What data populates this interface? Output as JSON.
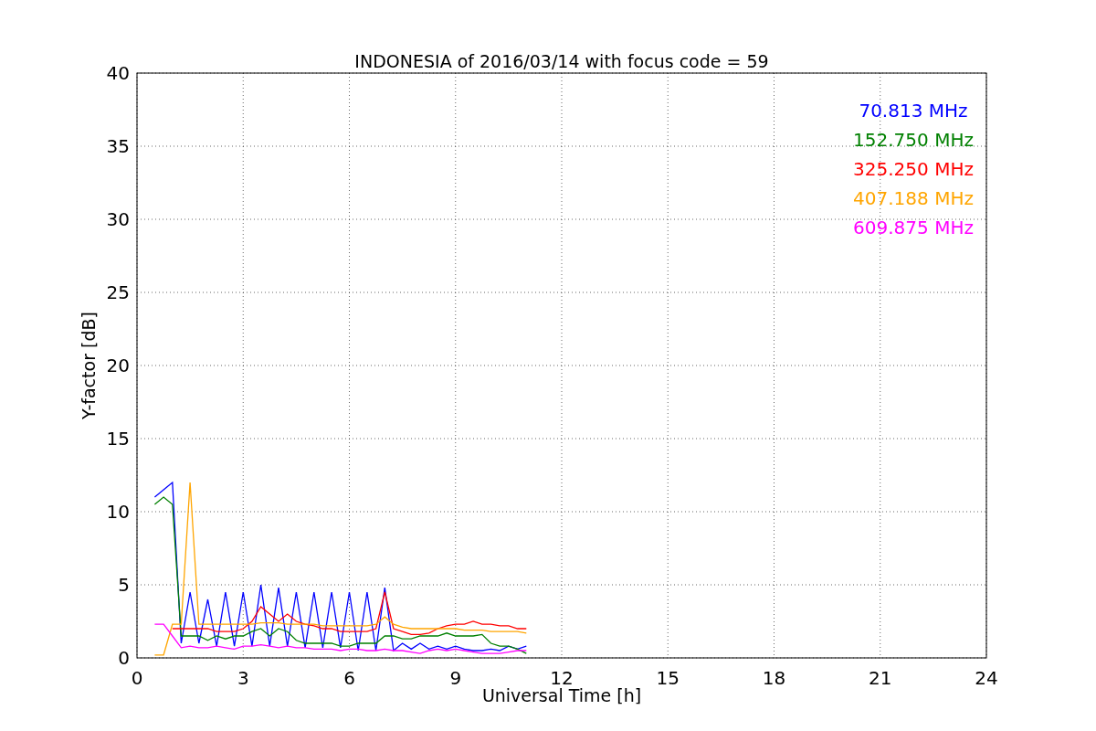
{
  "chart_data": {
    "type": "line",
    "title": "INDONESIA of 2016/03/14 with focus code = 59",
    "xlabel": "Universal Time [h]",
    "ylabel": "Y-factor [dB]",
    "x": [
      0.5,
      0.75,
      1,
      1.25,
      1.5,
      1.75,
      2,
      2.25,
      2.5,
      2.75,
      3,
      3.25,
      3.5,
      3.75,
      4,
      4.25,
      4.5,
      4.75,
      5,
      5.25,
      5.5,
      5.75,
      6,
      6.25,
      6.5,
      6.75,
      7,
      7.25,
      7.5,
      7.75,
      8,
      8.25,
      8.5,
      8.75,
      9,
      9.25,
      9.5,
      9.75,
      10,
      10.25,
      10.5,
      10.75,
      11
    ],
    "series": [
      {
        "name": "70.813 MHz",
        "color": "#0000ff",
        "values": [
          11,
          11.5,
          12,
          1,
          4.5,
          1,
          4,
          0.8,
          4.5,
          0.8,
          4.5,
          0.8,
          5,
          0.8,
          4.8,
          0.8,
          4.5,
          0.7,
          4.5,
          0.7,
          4.5,
          0.7,
          4.5,
          0.5,
          4.5,
          0.5,
          4.8,
          0.5,
          1,
          0.6,
          1,
          0.6,
          0.8,
          0.6,
          0.8,
          0.6,
          0.5,
          0.5,
          0.6,
          0.5,
          0.8,
          0.6,
          0.8
        ]
      },
      {
        "name": "152.750 MHz",
        "color": "#008000",
        "values": [
          10.5,
          11,
          10.5,
          1.5,
          1.5,
          1.5,
          1.2,
          1.5,
          1.3,
          1.5,
          1.5,
          1.8,
          2,
          1.5,
          2,
          1.8,
          1.2,
          1,
          1,
          1,
          1,
          0.8,
          0.8,
          1,
          1,
          1,
          1.5,
          1.5,
          1.3,
          1.3,
          1.5,
          1.5,
          1.5,
          1.7,
          1.5,
          1.5,
          1.5,
          1.6,
          1,
          0.8,
          0.8,
          0.6,
          0.3
        ]
      },
      {
        "name": "325.250 MHz",
        "color": "#ff0000",
        "values": [
          null,
          null,
          2,
          2,
          2,
          2,
          2,
          1.8,
          1.8,
          1.8,
          2,
          2.5,
          3.5,
          3,
          2.5,
          3,
          2.5,
          2.3,
          2.2,
          2,
          2,
          1.8,
          1.8,
          1.8,
          1.8,
          2,
          4.5,
          2,
          1.8,
          1.6,
          1.6,
          1.7,
          2,
          2.2,
          2.3,
          2.3,
          2.5,
          2.3,
          2.3,
          2.2,
          2.2,
          2,
          2
        ]
      },
      {
        "name": "407.188 MHz",
        "color": "#ffa500",
        "values": [
          0.2,
          0.2,
          2.3,
          2.3,
          12,
          2.3,
          2.3,
          2.3,
          2.3,
          2.3,
          2.3,
          2.3,
          2.4,
          2.4,
          2.4,
          2.3,
          2.3,
          2.3,
          2.3,
          2.2,
          2.2,
          2.2,
          2.2,
          2.2,
          2.2,
          2.3,
          2.8,
          2.3,
          2.1,
          2,
          2,
          2,
          2,
          2,
          2,
          1.9,
          1.9,
          1.9,
          1.8,
          1.8,
          1.8,
          1.8,
          1.7
        ]
      },
      {
        "name": "609.875 MHz",
        "color": "#ff00ff",
        "values": [
          2.3,
          2.3,
          1.5,
          0.7,
          0.8,
          0.7,
          0.7,
          0.8,
          0.7,
          0.6,
          0.8,
          0.8,
          0.9,
          0.8,
          0.7,
          0.8,
          0.7,
          0.7,
          0.6,
          0.6,
          0.6,
          0.5,
          0.6,
          0.6,
          0.5,
          0.5,
          0.6,
          0.5,
          0.5,
          0.4,
          0.3,
          0.5,
          0.6,
          0.5,
          0.6,
          0.5,
          0.4,
          0.3,
          0.3,
          0.3,
          0.4,
          0.5,
          0.5
        ]
      }
    ],
    "grid": true,
    "xlim": [
      0,
      24
    ],
    "ylim": [
      0,
      40
    ],
    "xticks": [
      0,
      3,
      6,
      9,
      12,
      15,
      18,
      21,
      24
    ],
    "yticks": [
      0,
      5,
      10,
      15,
      20,
      25,
      30,
      35,
      40
    ]
  }
}
